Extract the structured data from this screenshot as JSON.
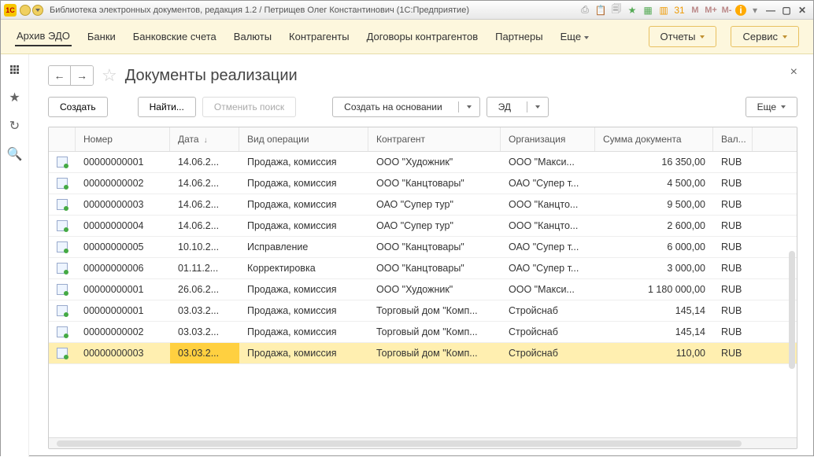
{
  "titlebar": {
    "logo_text": "1C",
    "title": "Библиотека электронных документов, редакция 1.2 / Петрищев Олег Константинович  (1С:Предприятие)"
  },
  "menu": {
    "items": [
      "Архив ЭДО",
      "Банки",
      "Банковские счета",
      "Валюты",
      "Контрагенты",
      "Договоры контрагентов",
      "Партнеры",
      "Еще"
    ],
    "reports": "Отчеты",
    "service": "Сервис"
  },
  "page": {
    "title": "Документы реализации"
  },
  "toolbar": {
    "create": "Создать",
    "find": "Найти...",
    "cancel": "Отменить поиск",
    "create_based": "Создать на основании",
    "ed": "ЭД",
    "more": "Еще"
  },
  "columns": {
    "number": "Номер",
    "date": "Дата",
    "op": "Вид операции",
    "kontragent": "Контрагент",
    "org": "Организация",
    "sum": "Сумма документа",
    "cur": "Вал..."
  },
  "rows": [
    {
      "num": "00000000001",
      "date": "14.06.2...",
      "op": "Продажа, комиссия",
      "kon": "ООО \"Художник\"",
      "org": "ООО \"Макси...",
      "sum": "16 350,00",
      "cur": "RUB"
    },
    {
      "num": "00000000002",
      "date": "14.06.2...",
      "op": "Продажа, комиссия",
      "kon": "ООО \"Канцтовары\"",
      "org": "ОАО \"Супер т...",
      "sum": "4 500,00",
      "cur": "RUB"
    },
    {
      "num": "00000000003",
      "date": "14.06.2...",
      "op": "Продажа, комиссия",
      "kon": "ОАО \"Супер тур\"",
      "org": "ООО \"Канцто...",
      "sum": "9 500,00",
      "cur": "RUB"
    },
    {
      "num": "00000000004",
      "date": "14.06.2...",
      "op": "Продажа, комиссия",
      "kon": "ОАО \"Супер тур\"",
      "org": "ООО \"Канцто...",
      "sum": "2 600,00",
      "cur": "RUB"
    },
    {
      "num": "00000000005",
      "date": "10.10.2...",
      "op": "Исправление",
      "kon": "ООО \"Канцтовары\"",
      "org": "ОАО \"Супер т...",
      "sum": "6 000,00",
      "cur": "RUB"
    },
    {
      "num": "00000000006",
      "date": "01.11.2...",
      "op": "Корректировка",
      "kon": "ООО \"Канцтовары\"",
      "org": "ОАО \"Супер т...",
      "sum": "3 000,00",
      "cur": "RUB"
    },
    {
      "num": "00000000001",
      "date": "26.06.2...",
      "op": "Продажа, комиссия",
      "kon": "ООО \"Художник\"",
      "org": "ООО \"Макси...",
      "sum": "1 180 000,00",
      "cur": "RUB"
    },
    {
      "num": "00000000001",
      "date": "03.03.2...",
      "op": "Продажа, комиссия",
      "kon": "Торговый дом \"Комп...",
      "org": "Стройснаб",
      "sum": "145,14",
      "cur": "RUB"
    },
    {
      "num": "00000000002",
      "date": "03.03.2...",
      "op": "Продажа, комиссия",
      "kon": "Торговый дом \"Комп...",
      "org": "Стройснаб",
      "sum": "145,14",
      "cur": "RUB"
    },
    {
      "num": "00000000003",
      "date": "03.03.2...",
      "op": "Продажа, комиссия",
      "kon": "Торговый дом \"Комп...",
      "org": "Стройснаб",
      "sum": "110,00",
      "cur": "RUB",
      "selected": true
    }
  ]
}
